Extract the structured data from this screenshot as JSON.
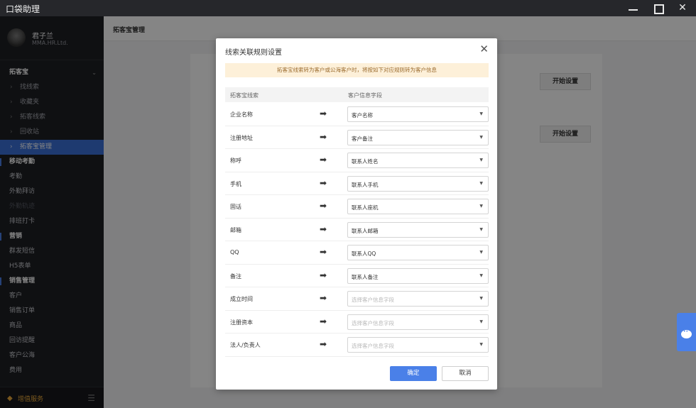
{
  "window": {
    "title": "口袋助理",
    "minimize_icon": "minimize-icon",
    "maximize_icon": "maximize-icon",
    "close_icon": "close-icon"
  },
  "profile": {
    "name": "君子兰",
    "company": "MMA.HR.Ltd."
  },
  "sidebar": {
    "items": [
      {
        "label": "拓客宝",
        "type": "group"
      },
      {
        "label": "找线索",
        "type": "sub"
      },
      {
        "label": "收藏夹",
        "type": "sub"
      },
      {
        "label": "拓客线索",
        "type": "sub"
      },
      {
        "label": "回收站",
        "type": "sub"
      },
      {
        "label": "拓客宝管理",
        "type": "sub",
        "active": true
      },
      {
        "label": "移动考勤",
        "type": "group"
      },
      {
        "label": "考勤",
        "type": "item"
      },
      {
        "label": "外勤拜访",
        "type": "item"
      },
      {
        "label": "外勤轨迹",
        "type": "item",
        "dim": true
      },
      {
        "label": "排班打卡",
        "type": "item"
      },
      {
        "label": "营销",
        "type": "group"
      },
      {
        "label": "群发短信",
        "type": "item"
      },
      {
        "label": "H5表单",
        "type": "item"
      },
      {
        "label": "销售管理",
        "type": "group"
      },
      {
        "label": "客户",
        "type": "item"
      },
      {
        "label": "销售订单",
        "type": "item"
      },
      {
        "label": "商品",
        "type": "item"
      },
      {
        "label": "回访提醒",
        "type": "item"
      },
      {
        "label": "客户公海",
        "type": "item"
      },
      {
        "label": "费用",
        "type": "item"
      }
    ],
    "bottom": {
      "label": "增值服务",
      "icon": "diamond-icon",
      "menu_icon": "menu-icon"
    }
  },
  "main": {
    "header": "拓客宝管理",
    "start_buttons": [
      "开始设置",
      "开始设置"
    ]
  },
  "dialog": {
    "title": "线索关联规则设置",
    "notice": "拓客宝线索转为客户或公海客户时，将按如下对应规则转为客户信息",
    "col_left": "拓客宝线索",
    "col_right": "客户信息字段",
    "rows": [
      {
        "label": "企业名称",
        "value": "客户名称",
        "placeholder": false
      },
      {
        "label": "注册地址",
        "value": "客户备注",
        "placeholder": false
      },
      {
        "label": "称呼",
        "value": "联系人姓名",
        "placeholder": false
      },
      {
        "label": "手机",
        "value": "联系人手机",
        "placeholder": false
      },
      {
        "label": "固话",
        "value": "联系人座机",
        "placeholder": false
      },
      {
        "label": "邮箱",
        "value": "联系人邮箱",
        "placeholder": false
      },
      {
        "label": "QQ",
        "value": "联系人QQ",
        "placeholder": false
      },
      {
        "label": "备注",
        "value": "联系人备注",
        "placeholder": false
      },
      {
        "label": "成立时间",
        "value": "选择客户信息字段",
        "placeholder": true
      },
      {
        "label": "注册资本",
        "value": "选择客户信息字段",
        "placeholder": true
      },
      {
        "label": "法人/负责人",
        "value": "选择客户信息字段",
        "placeholder": true
      }
    ],
    "ok": "确定",
    "cancel": "取消"
  },
  "floating": {
    "icon": "chat-icon"
  },
  "colors": {
    "accent": "#4a80e8",
    "sidebar": "#1d1f24",
    "notice_bg": "#fdf0d9"
  }
}
